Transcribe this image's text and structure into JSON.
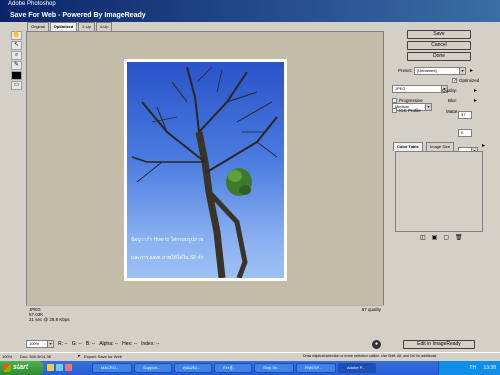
{
  "app_title": "Adobe Photoshop",
  "dialog_title": "Save For Web - Powered By ImageReady",
  "tabs": [
    "Original",
    "Optimized",
    "2-Up",
    "4-Up"
  ],
  "image_caption_line1": "น้อนูวาก้า How to ใส่กรอบรูปภาพ",
  "image_caption_line2": "และการ save ภาพให้ได้ใน SF จ้า",
  "info": {
    "format": "JPEG",
    "size": "57.03K",
    "time": "21 sec @ 28.8 Kbps",
    "quality": "57 quality"
  },
  "status_row": {
    "zoom": "100%",
    "fields": [
      "R: --",
      "G: --",
      "B: --",
      "Alpha: --",
      "Hex: --",
      "Index: --"
    ]
  },
  "buttons": {
    "save": "Save",
    "cancel": "Cancel",
    "done": "Done",
    "edit_imageready": "Edit in ImageReady"
  },
  "settings": {
    "preset_label": "Preset:",
    "preset_value": "[Unnamed]",
    "format_value": "JPEG",
    "quality_level": "Medium",
    "optimized_label": "Optimized",
    "quality_label": "Quality:",
    "quality_value": "57",
    "progressive_label": "Progressive",
    "blur_label": "Blur:",
    "blur_value": "0",
    "icc_label": "ICC Profile",
    "matte_label": "Matte:"
  },
  "color_tabs": [
    "Color Table",
    "Image Size"
  ],
  "bottom_status": {
    "zoom": "100%",
    "doc": "Doc: 549.3K/4.3K",
    "export": "Export: Save for Web",
    "hint": "Draw elliptical selection or move selection outline.  Use Shift, Alt, and Ctrl for additional"
  },
  "taskbar": {
    "start": "start",
    "items": [
      "MACRO...",
      "Support...",
      "คุณแจ่ม...",
      "กระทู้...",
      "Stop Se...",
      "PANTIP...",
      "Adobe P..."
    ],
    "lang": "TH",
    "clock": "13:38"
  }
}
